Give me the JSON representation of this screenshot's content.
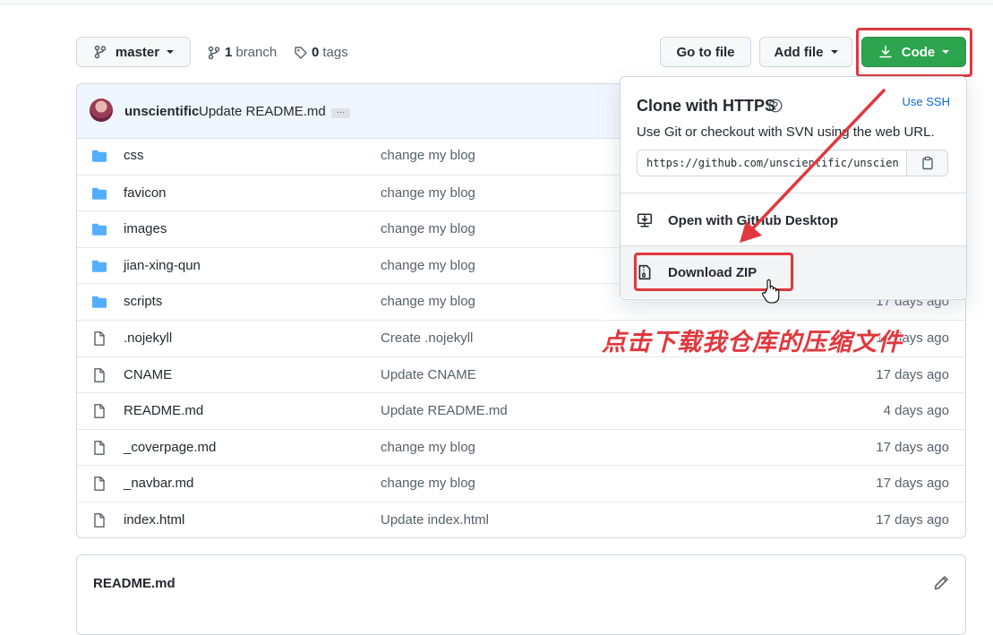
{
  "toolbar": {
    "branch_selector": "master",
    "branch_count": "1",
    "branch_label": "branch",
    "tag_count": "0",
    "tag_label": "tags",
    "go_to_file": "Go to file",
    "add_file": "Add file",
    "code": "Code"
  },
  "commit": {
    "user": "unscientific",
    "message": "Update README.md"
  },
  "files": [
    {
      "type": "folder",
      "name": "css",
      "message": "change my blog",
      "age": ""
    },
    {
      "type": "folder",
      "name": "favicon",
      "message": "change my blog",
      "age": ""
    },
    {
      "type": "folder",
      "name": "images",
      "message": "change my blog",
      "age": ""
    },
    {
      "type": "folder",
      "name": "jian-xing-qun",
      "message": "change my blog",
      "age": ""
    },
    {
      "type": "folder",
      "name": "scripts",
      "message": "change my blog",
      "age": "17 days ago"
    },
    {
      "type": "file",
      "name": ".nojekyll",
      "message": "Create .nojekyll",
      "age": "17 days ago"
    },
    {
      "type": "file",
      "name": "CNAME",
      "message": "Update CNAME",
      "age": "17 days ago"
    },
    {
      "type": "file",
      "name": "README.md",
      "message": "Update README.md",
      "age": "4 days ago"
    },
    {
      "type": "file",
      "name": "_coverpage.md",
      "message": "change my blog",
      "age": "17 days ago"
    },
    {
      "type": "file",
      "name": "_navbar.md",
      "message": "change my blog",
      "age": "17 days ago"
    },
    {
      "type": "file",
      "name": "index.html",
      "message": "Update index.html",
      "age": "17 days ago"
    }
  ],
  "readme": {
    "title": "README.md"
  },
  "clone_menu": {
    "title": "Clone with HTTPS",
    "use_ssh": "Use SSH",
    "description": "Use Git or checkout with SVN using the web URL.",
    "url": "https://github.com/unscientific/unscientific.github.io.git",
    "open_desktop": "Open with GitHub Desktop",
    "download_zip": "Download ZIP"
  },
  "annotation": "点击下载我仓库的压缩文件",
  "colors": {
    "code_button": "#2da44e",
    "highlight_box": "#e0383e",
    "folder_icon": "#54aeff",
    "link": "#0969da"
  }
}
